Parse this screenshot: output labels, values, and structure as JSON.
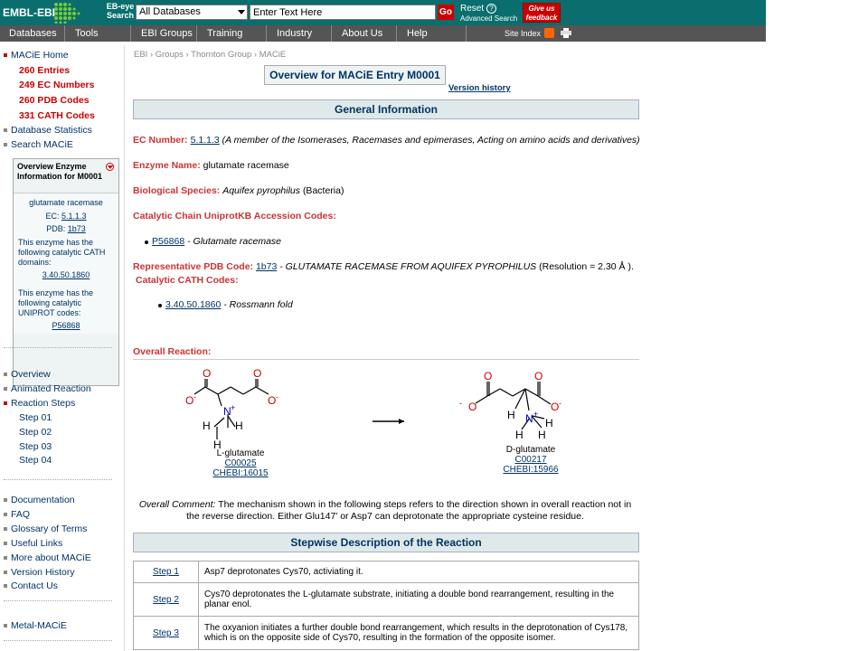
{
  "header": {
    "logo": "EMBL-EBI",
    "ebeye": "EB-eye Search",
    "db_select": "All Databases",
    "search_value": "Enter Text Here",
    "go": "Go",
    "reset": "Reset",
    "help_q": "?",
    "advanced": "Advanced Search",
    "feedback": "Give us feedback"
  },
  "nav": {
    "items": [
      "Databases",
      "Tools",
      "EBI Groups",
      "Training",
      "Industry",
      "About Us",
      "Help"
    ],
    "site_index": "Site Index"
  },
  "sidebar": {
    "home": "MACiE Home",
    "subs": [
      "260 Entries",
      "249 EC Numbers",
      "260 PDB Codes",
      "331 CATH Codes"
    ],
    "stats": "Database Statistics",
    "search": "Search MACiE",
    "overview_box": {
      "title": "Overview Enzyme Information for M0001",
      "name": "glutamate racemase",
      "ec_label": "EC:",
      "ec": "5.1.1.3",
      "pdb_label": "PDB:",
      "pdb": "1b73",
      "cath_text": "This enzyme has the following catalytic CATH domains:",
      "cath": "3.40.50.1860",
      "uniprot_text": "This enzyme has the following catalytic UNIPROT codes:",
      "uniprot": "P56868"
    },
    "group2": [
      "Overview",
      "Animated Reaction",
      "Reaction Steps"
    ],
    "steps": [
      "Step 01",
      "Step 02",
      "Step 03",
      "Step 04"
    ],
    "group3": [
      "Documentation",
      "FAQ",
      "Glossary of Terms",
      "Useful Links",
      "More about MACiE",
      "Version History",
      "Contact Us"
    ],
    "metal": "Metal-MACiE"
  },
  "main": {
    "breadcrumb": "EBI  › Groups  › Thornton Group  › MACiE",
    "title": "Overview for MACiE Entry M0001",
    "version_history": "Version history",
    "general_info": "General Information",
    "ec_label": "EC Number:",
    "ec_value": "5.1.1.3",
    "ec_desc": "(A member of the Isomerases, Racemases and epimerases, Acting on amino acids and derivatives)",
    "enzyme_label": "Enzyme Name:",
    "enzyme_value": "glutamate racemase",
    "species_label": "Biological Species:",
    "species_value": "Aquifex pyrophilus",
    "species_kingdom": "(Bacteria)",
    "uniprot_label": "Catalytic Chain UniprotKB Accession Codes:",
    "uniprot_code": "P56868",
    "uniprot_desc": "- Glutamate racemase",
    "pdb_label": "Representative PDB Code:",
    "pdb_code": "1b73",
    "pdb_desc": "- GLUTAMATE RACEMASE FROM AQUIFEX PYROPHILUS",
    "pdb_res": "(Resolution = 2.30 Å ).",
    "cath_label": "Catalytic CATH Codes:",
    "cath_code": "3.40.50.1860",
    "cath_desc": "- Rossmann fold",
    "overall_label": "Overall Reaction:",
    "reactant": {
      "name": "L-glutamate",
      "kegg": "C00025",
      "chebi": "CHEBI:16015"
    },
    "product": {
      "name": "D-glutamate",
      "kegg": "C00217",
      "chebi": "CHEBI:15966"
    },
    "comment_label": "Overall Comment:",
    "comment": "The mechanism shown in the following steps refers to the direction shown in overall reaction not in the reverse direction. Either Glu147' or Asp7 can deprotonate the appropriate cysteine residue.",
    "stepwise": "Stepwise Description of the Reaction",
    "steps": [
      {
        "label": "Step 1",
        "text": "Asp7 deprotonates Cys70, activiating it."
      },
      {
        "label": "Step 2",
        "text": "Cys70 deprotonates the L-glutamate substrate, initiating a double bond rearrangement, resulting in the planar enol."
      },
      {
        "label": "Step 3",
        "text": "The oxyanion initiates a further double bond rearrangement, which results in the deprotonation of Cys178, which is on the opposite side of Cys70, resulting in the formation of the opposite isomer."
      }
    ]
  },
  "chem": {
    "O": "O",
    "Ominus": "-",
    "N": "N",
    "Nplus": "+",
    "H": "H"
  }
}
